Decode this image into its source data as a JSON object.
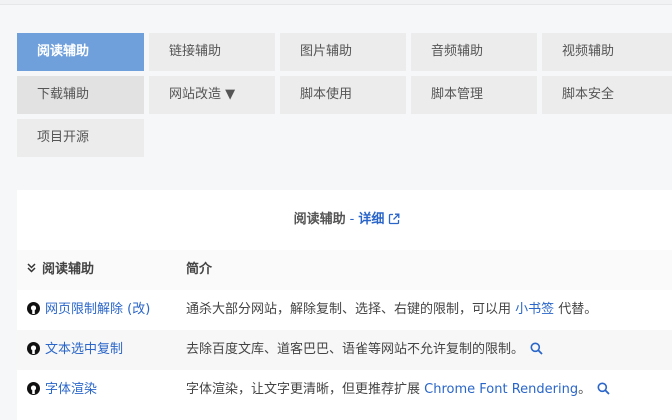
{
  "tabs": [
    {
      "label": "阅读辅助"
    },
    {
      "label": "链接辅助"
    },
    {
      "label": "图片辅助"
    },
    {
      "label": "音频辅助"
    },
    {
      "label": "视频辅助"
    },
    {
      "label": "下载辅助"
    },
    {
      "label": "网站改造 ▼"
    },
    {
      "label": "脚本使用"
    },
    {
      "label": "脚本管理"
    },
    {
      "label": "脚本安全"
    },
    {
      "label": "项目开源"
    }
  ],
  "panel": {
    "title": "阅读辅助",
    "separator": "-",
    "detail_label": "详细"
  },
  "table": {
    "col_name": "阅读辅助",
    "col_desc": "简介",
    "rows": [
      {
        "name": "网页限制解除 (改)",
        "desc_before": "通杀大部分网站，解除复制、选择、右键的限制，可以用 ",
        "desc_link": "小书签",
        "desc_after": " 代替。"
      },
      {
        "name": "文本选中复制",
        "desc_before": "去除百度文库、道客巴巴、语雀等网站不允许复制的限制。",
        "desc_link": "",
        "desc_after": ""
      },
      {
        "name": "字体渲染",
        "desc_before": "字体渲染，让文字更清晰，但更推荐扩展 ",
        "desc_link": "Chrome Font Rendering",
        "desc_after": "。"
      }
    ]
  },
  "colors": {
    "active_tab": "#6fa0dc",
    "link": "#2a66c9",
    "tab_bg": "#ececec"
  },
  "icons": {
    "row_icon": "github-icon",
    "search": "magnifier-icon",
    "external": "external-link-icon",
    "collapse": "double-chevron-down-icon"
  }
}
